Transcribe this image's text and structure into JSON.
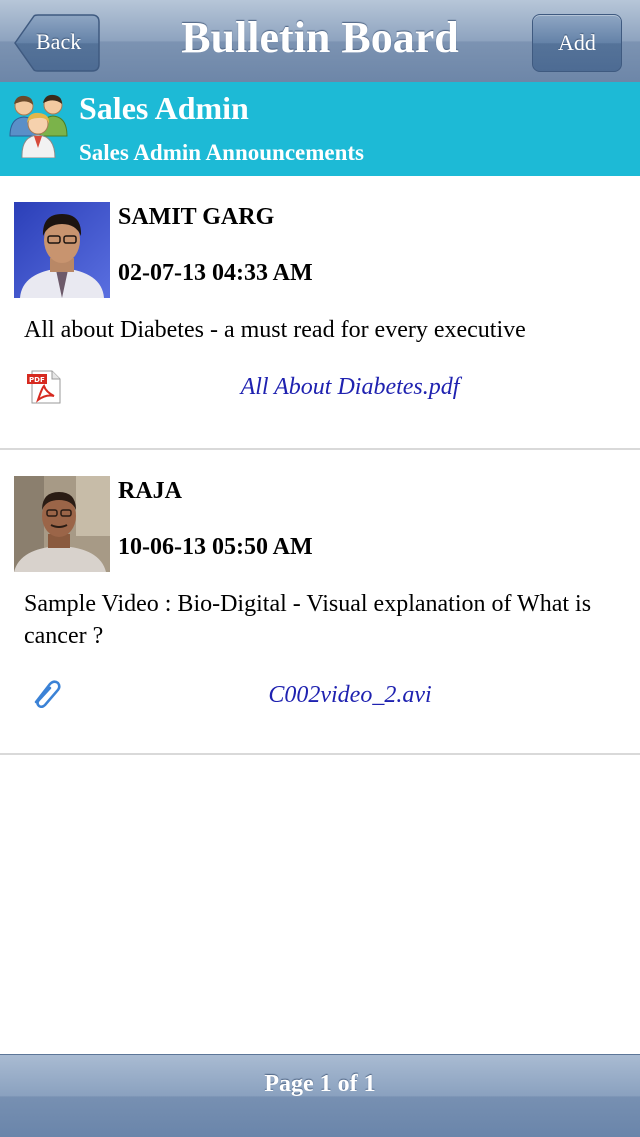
{
  "navbar": {
    "title": "Bulletin Board",
    "back_label": "Back",
    "add_label": "Add"
  },
  "group": {
    "icon": "users-group-icon",
    "title": "Sales Admin",
    "subtitle": "Sales Admin Announcements"
  },
  "posts": [
    {
      "author": "SAMIT GARG",
      "date": "02-07-13 04:33 AM",
      "message": "All about Diabetes - a must read for every executive",
      "attachment": {
        "icon": "pdf-file-icon",
        "name": "All About Diabetes.pdf"
      }
    },
    {
      "author": "RAJA",
      "date": "10-06-13 05:50 AM",
      "message": "Sample Video : Bio-Digital - Visual explanation of What is cancer ?",
      "attachment": {
        "icon": "paperclip-icon",
        "name": "C002video_2.avi"
      }
    }
  ],
  "footer": {
    "page_label": "Page 1 of 1"
  },
  "colors": {
    "group_header": "#1dbad6",
    "link": "#1f22b0",
    "navbar": "#7c93b2"
  }
}
